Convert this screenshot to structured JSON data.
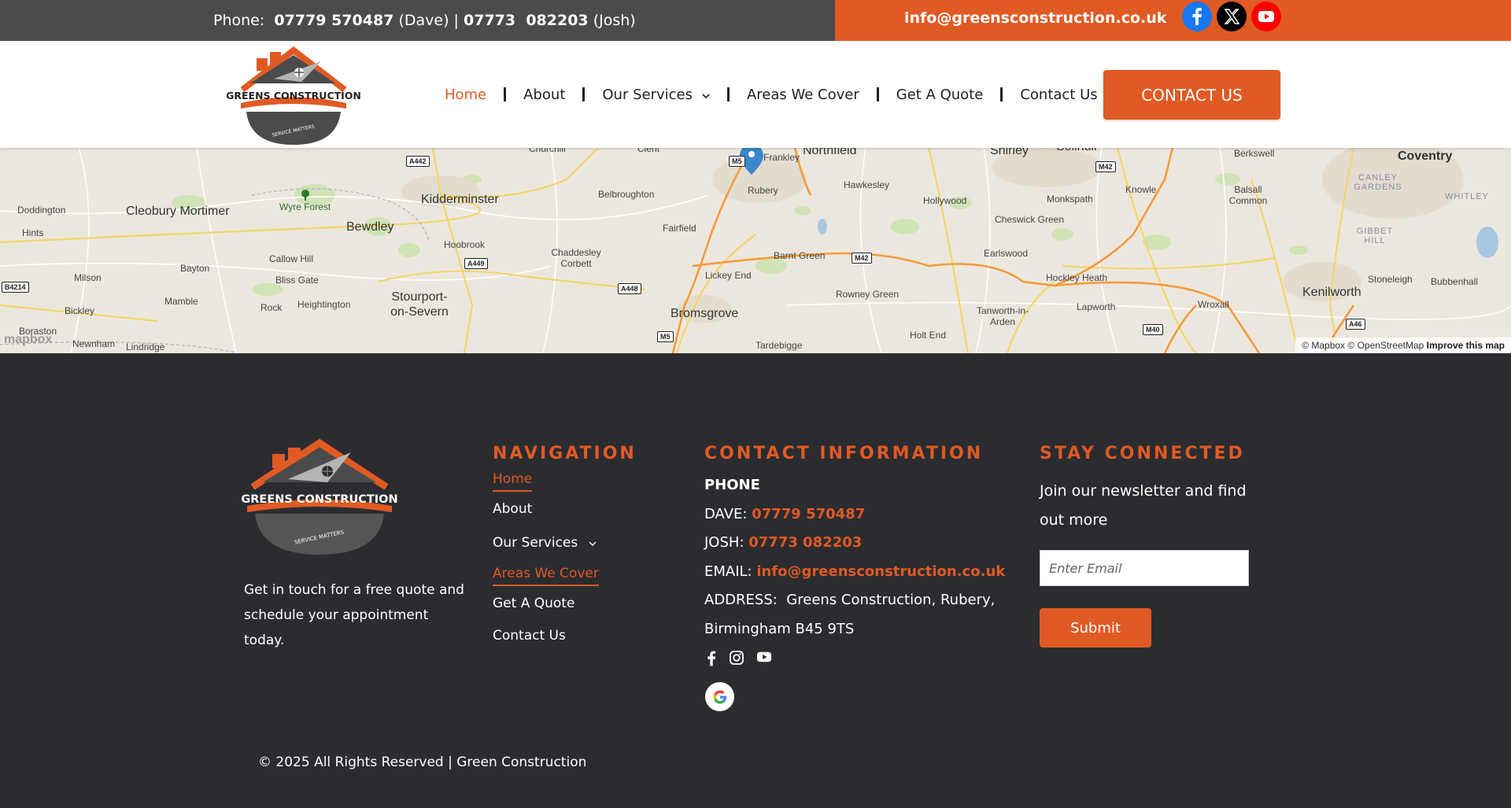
{
  "topbar": {
    "phone_label": "Phone:",
    "phone_dave": "07779 570487",
    "dave_label": "(Dave)",
    "separator": "|",
    "phone_josh": "07773  082203",
    "josh_label": "(Josh)",
    "email": "info@greensconstruction.co.uk",
    "social": [
      "facebook-icon",
      "x-twitter-icon",
      "youtube-icon"
    ]
  },
  "brand": {
    "name": "GREENS CONSTRUCTION",
    "tagline": "SERVICE MATTERS",
    "accent": "#e05a24",
    "dark": "#2b2c30"
  },
  "nav": {
    "items": [
      {
        "label": "Home",
        "active": true
      },
      {
        "label": "About"
      },
      {
        "label": "Our Services",
        "dropdown": true
      },
      {
        "label": "Areas We Cover"
      },
      {
        "label": "Get A Quote"
      },
      {
        "label": "Contact Us"
      }
    ],
    "cta": "CONTACT US"
  },
  "map": {
    "places": [
      "Doddington",
      "Cleobury Mortimer",
      "Hints",
      "Wyre Forest",
      "Kidderminster",
      "Bewdley",
      "Belbroughton",
      "Fairfield",
      "Rubery",
      "Frankley",
      "Northfield",
      "Hawkesley",
      "Shirley",
      "Solihull",
      "Hollywood",
      "Monkspath",
      "Knowle",
      "Berkswell",
      "Coventry",
      "Balsall Common",
      "Canley Gardens",
      "Whitley",
      "Gibbet Hill",
      "Hoobrook",
      "Chaddesley Corbett",
      "Callow Hill",
      "Bliss Gate",
      "Bayton",
      "Milson",
      "Mamble",
      "Bickley",
      "Boraston",
      "Newnham",
      "Lindridge",
      "Rock",
      "Heightington",
      "Stourport-on-Severn",
      "Lickey End",
      "Barnt Green",
      "Bromsgrove",
      "Rowney Green",
      "Tardebigge",
      "Holt End",
      "Tanworth-in-Arden",
      "Earlswood",
      "Cheswick Green",
      "Hockley Heath",
      "Lapworth",
      "Wroxall",
      "Kenilworth",
      "Stoneleigh",
      "Bubbenhall",
      "Churchill",
      "Clent"
    ],
    "roads": [
      "A442",
      "M5",
      "M42",
      "A449",
      "A448",
      "M5",
      "B4214",
      "M42",
      "M40",
      "A46"
    ],
    "attribution_mapbox": "© Mapbox",
    "attribution_osm": "© OpenStreetMap",
    "attribution_improve": "Improve this map",
    "logo": "mapbox"
  },
  "footer": {
    "tagline": "Get in touch for a free quote and schedule your appointment today.",
    "nav_heading": "NAVIGATION",
    "nav_items": [
      {
        "label": "Home",
        "current": true
      },
      {
        "label": "About"
      },
      {
        "label": "Our Services",
        "dropdown": true
      },
      {
        "label": "Areas We Cover",
        "current": true
      },
      {
        "label": "Get A Quote"
      },
      {
        "label": "Contact Us"
      }
    ],
    "contact_heading": "CONTACT INFORMATION",
    "phone_heading": "PHONE",
    "dave_label": "DAVE:",
    "dave_phone": "07779 570487",
    "josh_label": "JOSH:",
    "josh_phone": "07773 082203",
    "email_label": "EMAIL:",
    "email": "info@greensconstruction.co.uk",
    "address_label": "ADDRESS:",
    "address": "Greens Construction, Rubery, Birmingham B45 9TS",
    "social": [
      "facebook-icon",
      "instagram-icon",
      "youtube-icon"
    ],
    "newsletter_heading": "STAY CONNECTED",
    "newsletter_text": "Join our newsletter and find out more",
    "email_placeholder": "Enter Email",
    "submit": "Submit",
    "copyright": "© 2025 All Rights Reserved | Green Construction"
  }
}
